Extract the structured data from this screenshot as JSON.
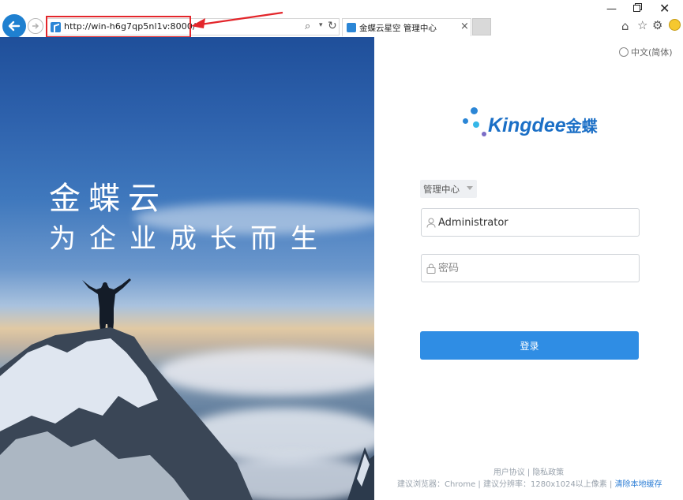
{
  "browser": {
    "url": "http://win-h6g7qp5nl1v:8000/",
    "tab_title": "金蝶云星空 管理中心",
    "tab_close": "×",
    "icons": [
      "back-arrow-icon",
      "forward-arrow-icon",
      "search-icon",
      "refresh-icon",
      "home-icon",
      "star-icon",
      "gear-icon",
      "smiley-icon"
    ]
  },
  "hero": {
    "title": "金蝶云",
    "subtitle": "为企业成长而生"
  },
  "login": {
    "language": "中文(简体)",
    "logo_text": "Kingdee",
    "logo_cn": "金蝶",
    "datacenter": "管理中心",
    "username": "Administrator",
    "password_placeholder": "密码",
    "login_label": "登录"
  },
  "footer": {
    "user_agreement": "用户协议",
    "separator": "|",
    "privacy": "隐私政策",
    "browser_hint": "建议浏览器：Chrome",
    "resolution_hint": "建议分辨率：1280x1024以上像素",
    "clear_cache": "清除本地缓存"
  },
  "colors": {
    "accent": "#2f8de4",
    "brand": "#1b6fc6",
    "annotation": "#e3262b"
  }
}
